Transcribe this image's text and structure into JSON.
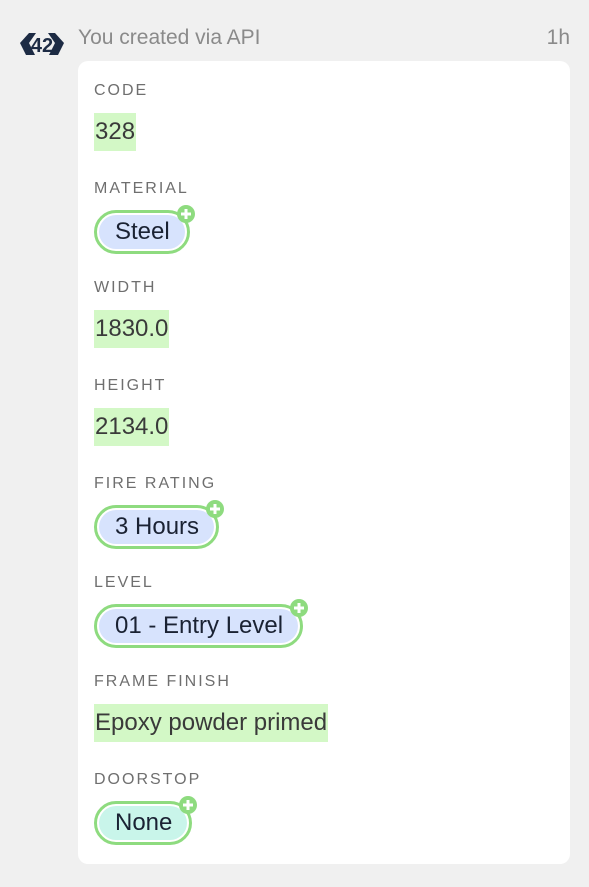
{
  "header": {
    "logo_icon": "app-logo-icon",
    "activity_text": "You created via API",
    "time_ago": "1h"
  },
  "colors": {
    "added_value_bg": "#d3f8c6",
    "pill_border": "#8edb7f",
    "pill_blue": "#d7e3fd",
    "pill_teal": "#c9f5ea"
  },
  "fields": [
    {
      "label": "CODE",
      "value": "328",
      "type": "text"
    },
    {
      "label": "MATERIAL",
      "value": "Steel",
      "type": "pill"
    },
    {
      "label": "WIDTH",
      "value": "1830.0",
      "type": "text"
    },
    {
      "label": "HEIGHT",
      "value": "2134.0",
      "type": "text"
    },
    {
      "label": "FIRE RATING",
      "value": "3 Hours",
      "type": "pill"
    },
    {
      "label": "LEVEL",
      "value": "01 - Entry Level",
      "type": "pill"
    },
    {
      "label": "FRAME FINISH",
      "value": "Epoxy powder primed",
      "type": "text"
    },
    {
      "label": "DOORSTOP",
      "value": "None",
      "type": "pill",
      "pill_color": "teal"
    }
  ]
}
